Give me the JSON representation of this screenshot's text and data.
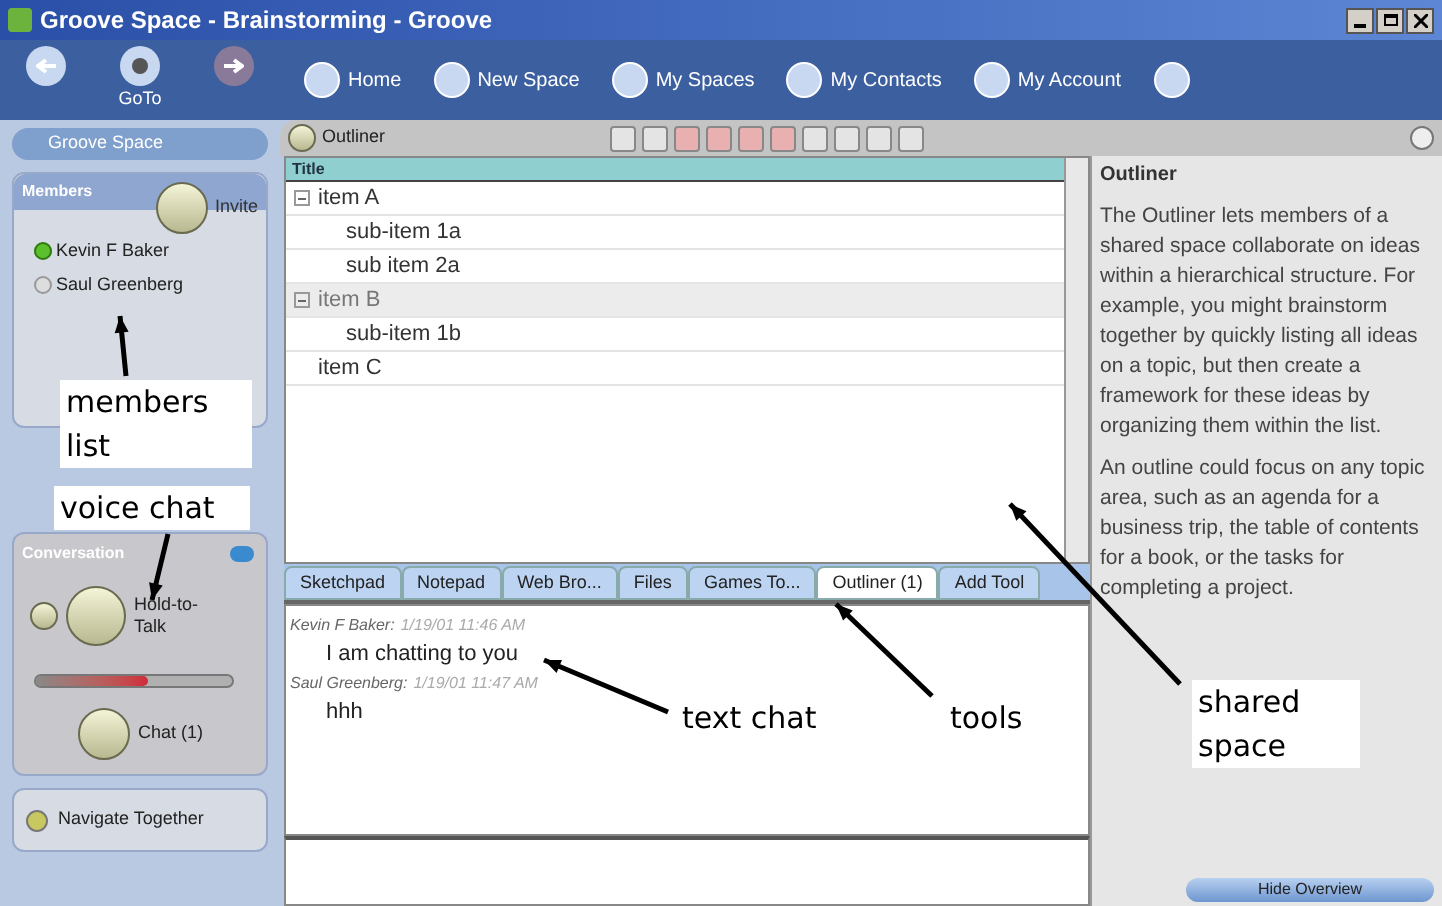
{
  "window": {
    "title": "Groove Space - Brainstorming - Groove"
  },
  "nav_buttons": [
    {
      "kind": "back"
    },
    {
      "kind": "goto",
      "label": "GoTo"
    },
    {
      "kind": "forward"
    }
  ],
  "top_nav": [
    {
      "label": "Home"
    },
    {
      "label": "New Space"
    },
    {
      "label": "My Spaces"
    },
    {
      "label": "My Contacts"
    },
    {
      "label": "My Account"
    }
  ],
  "space_button": "Groove Space",
  "members": {
    "title": "Members",
    "invite": "Invite",
    "items": [
      {
        "name": "Kevin F Baker",
        "online": true
      },
      {
        "name": "Saul Greenberg",
        "online": false
      }
    ]
  },
  "conversation": {
    "title": "Conversation",
    "hold_to_talk": "Hold-to-Talk",
    "level": 0.57,
    "chat": "Chat (1)"
  },
  "navigate_together": "Navigate Together",
  "tool_header": {
    "title": "Outliner"
  },
  "outline": {
    "column": "Title",
    "items": [
      {
        "label": "item A",
        "selected": false,
        "children": [
          {
            "label": "sub-item 1a",
            "selected": false
          },
          {
            "label": "sub item 2a",
            "selected": false
          }
        ]
      },
      {
        "label": "item B",
        "selected": true,
        "children": [
          {
            "label": "sub-item 1b",
            "selected": false
          }
        ]
      },
      {
        "label": "item C",
        "selected": false
      }
    ]
  },
  "tabs": [
    {
      "label": "Sketchpad",
      "selected": false
    },
    {
      "label": "Notepad",
      "selected": false
    },
    {
      "label": "Web Bro...",
      "selected": false
    },
    {
      "label": "Files",
      "selected": false
    },
    {
      "label": "Games To...",
      "selected": false
    },
    {
      "label": "Outliner (1)",
      "selected": true
    },
    {
      "label": "Add Tool",
      "selected": false
    }
  ],
  "chat": [
    {
      "author": "Kevin F Baker:",
      "time": "1/19/01 11:46 AM",
      "text": "I am chatting to you"
    },
    {
      "author": "Saul Greenberg:",
      "time": "1/19/01 11:47 AM",
      "text": "hhh"
    }
  ],
  "overview": {
    "title": "Outliner",
    "paragraphs": [
      "The Outliner lets members of a shared space collaborate on ideas within a hierarchical structure. For example, you might brainstorm together by quickly listing all ideas on a topic, but then create a framework for these ideas by organizing them within the list.",
      "An outline could focus on any topic area, such as an agenda for a business trip, the table of contents for a book, or the tasks for completing a project."
    ],
    "hide_button": "Hide Overview"
  },
  "annotations": [
    {
      "label": "members list"
    },
    {
      "label": "voice chat"
    },
    {
      "label": "text chat"
    },
    {
      "label": "tools"
    },
    {
      "label": "shared space"
    }
  ]
}
